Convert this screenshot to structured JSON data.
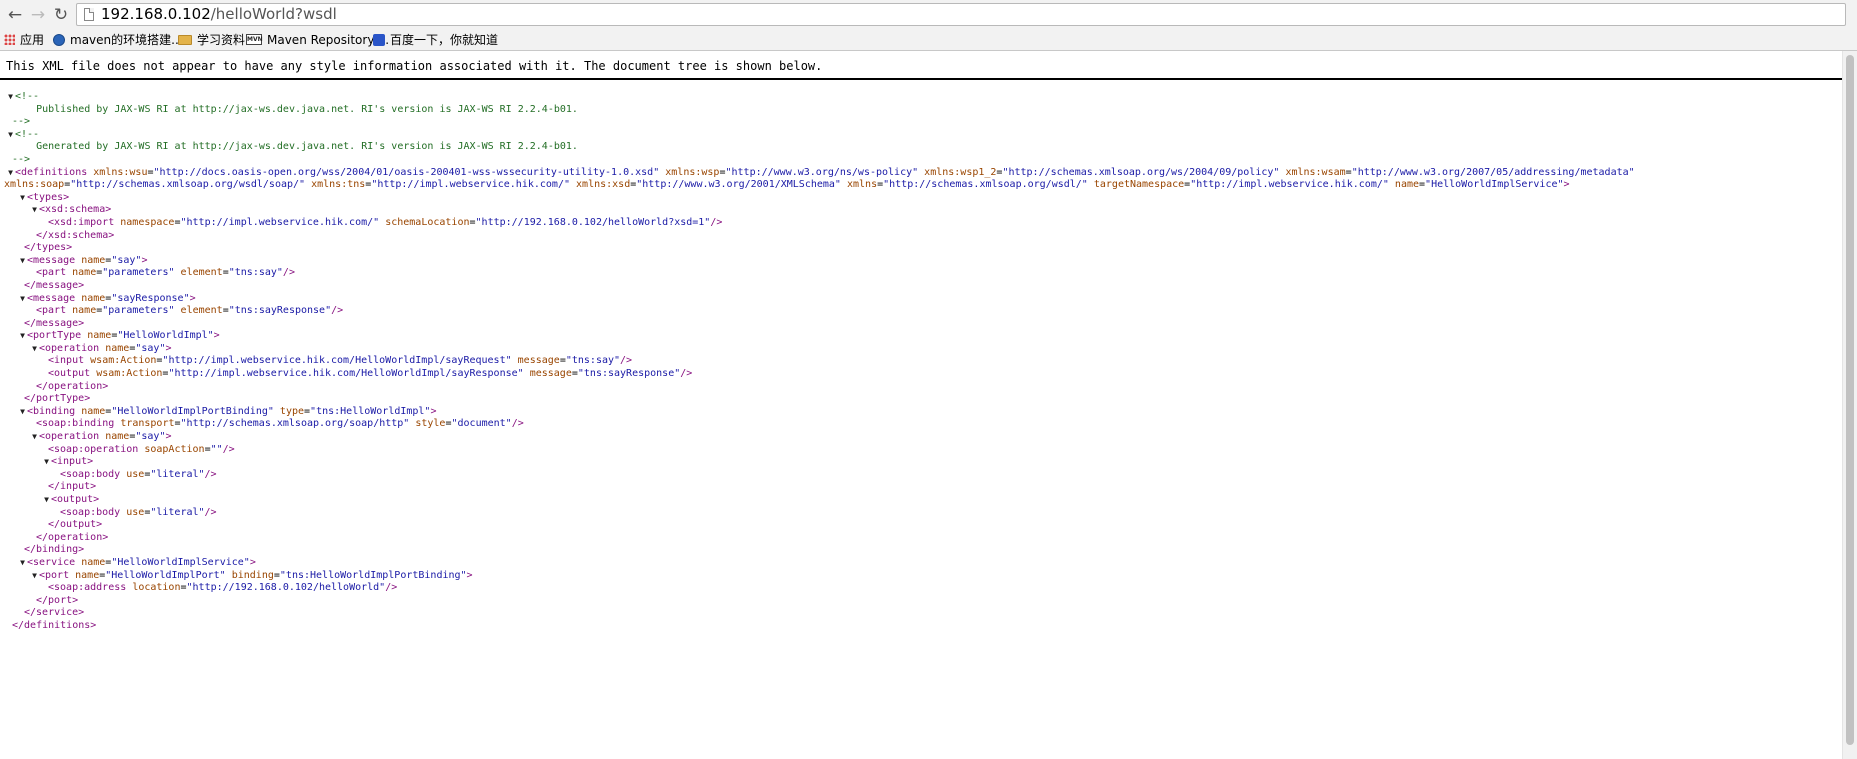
{
  "browser": {
    "back_icon": "←",
    "forward_icon": "→",
    "reload_icon": "↻",
    "url_host": "192.168.0.102",
    "url_path": "/helloWorld?wsdl"
  },
  "bookmarks": [
    {
      "label": "应用",
      "icon": "apps-icon"
    },
    {
      "label": "maven的环境搭建...",
      "icon": "site-icon"
    },
    {
      "label": "学习资料",
      "icon": "folder-icon"
    },
    {
      "label": "Maven Repository:...",
      "icon": "mvn-icon",
      "badge": "MVN"
    },
    {
      "label": "百度一下，你就知道",
      "icon": "baidu-icon"
    }
  ],
  "notice": "This XML file does not appear to have any style information associated with it. The document tree is shown below.",
  "lines": [
    {
      "toggle": "▼",
      "tokens": [
        {
          "t": "<!--",
          "c": "cm"
        }
      ]
    },
    {
      "tokens": [
        {
          "t": "    Published by JAX-WS RI at http://jax-ws.dev.java.net. RI's version is JAX-WS RI 2.2.4-b01.",
          "c": "cm"
        }
      ]
    },
    {
      "tokens": [
        {
          "t": "-->",
          "c": "cm"
        }
      ]
    },
    {
      "toggle": "▼",
      "tokens": [
        {
          "t": "<!--",
          "c": "cm"
        }
      ]
    },
    {
      "tokens": [
        {
          "t": "    Generated by JAX-WS RI at http://jax-ws.dev.java.net. RI's version is JAX-WS RI 2.2.4-b01.",
          "c": "cm"
        }
      ]
    },
    {
      "tokens": [
        {
          "t": "-->",
          "c": "cm"
        }
      ]
    },
    {
      "toggle": "▼",
      "tokens": [
        {
          "t": "<definitions",
          "c": "tag"
        },
        {
          "t": " "
        },
        {
          "t": "xmlns:wsu",
          "c": "an"
        },
        {
          "t": "="
        },
        {
          "t": "\"http://docs.oasis-open.org/wss/2004/01/oasis-200401-wss-wssecurity-utility-1.0.xsd\"",
          "c": "av"
        },
        {
          "t": " "
        },
        {
          "t": "xmlns:wsp",
          "c": "an"
        },
        {
          "t": "="
        },
        {
          "t": "\"http://www.w3.org/ns/ws-policy\"",
          "c": "av"
        },
        {
          "t": " "
        },
        {
          "t": "xmlns:wsp1_2",
          "c": "an"
        },
        {
          "t": "="
        },
        {
          "t": "\"http://schemas.xmlsoap.org/ws/2004/09/policy\"",
          "c": "av"
        },
        {
          "t": " "
        },
        {
          "t": "xmlns:wsam",
          "c": "an"
        },
        {
          "t": "="
        },
        {
          "t": "\"http://www.w3.org/2007/05/addressing/metadata\"",
          "c": "av"
        }
      ]
    },
    {
      "indent": -1,
      "tokens": [
        {
          "t": "xmlns:soap",
          "c": "an"
        },
        {
          "t": "="
        },
        {
          "t": "\"http://schemas.xmlsoap.org/wsdl/soap/\"",
          "c": "av"
        },
        {
          "t": " "
        },
        {
          "t": "xmlns:tns",
          "c": "an"
        },
        {
          "t": "="
        },
        {
          "t": "\"http://impl.webservice.hik.com/\"",
          "c": "av"
        },
        {
          "t": " "
        },
        {
          "t": "xmlns:xsd",
          "c": "an"
        },
        {
          "t": "="
        },
        {
          "t": "\"http://www.w3.org/2001/XMLSchema\"",
          "c": "av"
        },
        {
          "t": " "
        },
        {
          "t": "xmlns",
          "c": "an"
        },
        {
          "t": "="
        },
        {
          "t": "\"http://schemas.xmlsoap.org/wsdl/\"",
          "c": "av"
        },
        {
          "t": " "
        },
        {
          "t": "targetNamespace",
          "c": "an"
        },
        {
          "t": "="
        },
        {
          "t": "\"http://impl.webservice.hik.com/\"",
          "c": "av"
        },
        {
          "t": " "
        },
        {
          "t": "name",
          "c": "an"
        },
        {
          "t": "="
        },
        {
          "t": "\"HelloWorldImplService\"",
          "c": "av"
        },
        {
          "t": ">",
          "c": "tag"
        }
      ]
    },
    {
      "indent": 1,
      "toggle": "▼",
      "tokens": [
        {
          "t": "<types>",
          "c": "tag"
        }
      ]
    },
    {
      "indent": 2,
      "toggle": "▼",
      "tokens": [
        {
          "t": "<xsd:schema>",
          "c": "tag"
        }
      ]
    },
    {
      "indent": 3,
      "tokens": [
        {
          "t": "<xsd:import",
          "c": "tag"
        },
        {
          "t": " "
        },
        {
          "t": "namespace",
          "c": "an"
        },
        {
          "t": "="
        },
        {
          "t": "\"http://impl.webservice.hik.com/\"",
          "c": "av"
        },
        {
          "t": " "
        },
        {
          "t": "schemaLocation",
          "c": "an"
        },
        {
          "t": "="
        },
        {
          "t": "\"http://192.168.0.102/helloWorld?xsd=1\"",
          "c": "av"
        },
        {
          "t": "/>",
          "c": "tag"
        }
      ]
    },
    {
      "indent": 2,
      "tokens": [
        {
          "t": "</xsd:schema>",
          "c": "tag"
        }
      ]
    },
    {
      "indent": 1,
      "tokens": [
        {
          "t": "</types>",
          "c": "tag"
        }
      ]
    },
    {
      "indent": 1,
      "toggle": "▼",
      "tokens": [
        {
          "t": "<message",
          "c": "tag"
        },
        {
          "t": " "
        },
        {
          "t": "name",
          "c": "an"
        },
        {
          "t": "="
        },
        {
          "t": "\"say\"",
          "c": "av"
        },
        {
          "t": ">",
          "c": "tag"
        }
      ]
    },
    {
      "indent": 2,
      "tokens": [
        {
          "t": "<part",
          "c": "tag"
        },
        {
          "t": " "
        },
        {
          "t": "name",
          "c": "an"
        },
        {
          "t": "="
        },
        {
          "t": "\"parameters\"",
          "c": "av"
        },
        {
          "t": " "
        },
        {
          "t": "element",
          "c": "an"
        },
        {
          "t": "="
        },
        {
          "t": "\"tns:say\"",
          "c": "av"
        },
        {
          "t": "/>",
          "c": "tag"
        }
      ]
    },
    {
      "indent": 1,
      "tokens": [
        {
          "t": "</message>",
          "c": "tag"
        }
      ]
    },
    {
      "indent": 1,
      "toggle": "▼",
      "tokens": [
        {
          "t": "<message",
          "c": "tag"
        },
        {
          "t": " "
        },
        {
          "t": "name",
          "c": "an"
        },
        {
          "t": "="
        },
        {
          "t": "\"sayResponse\"",
          "c": "av"
        },
        {
          "t": ">",
          "c": "tag"
        }
      ]
    },
    {
      "indent": 2,
      "tokens": [
        {
          "t": "<part",
          "c": "tag"
        },
        {
          "t": " "
        },
        {
          "t": "name",
          "c": "an"
        },
        {
          "t": "="
        },
        {
          "t": "\"parameters\"",
          "c": "av"
        },
        {
          "t": " "
        },
        {
          "t": "element",
          "c": "an"
        },
        {
          "t": "="
        },
        {
          "t": "\"tns:sayResponse\"",
          "c": "av"
        },
        {
          "t": "/>",
          "c": "tag"
        }
      ]
    },
    {
      "indent": 1,
      "tokens": [
        {
          "t": "</message>",
          "c": "tag"
        }
      ]
    },
    {
      "indent": 1,
      "toggle": "▼",
      "tokens": [
        {
          "t": "<portType",
          "c": "tag"
        },
        {
          "t": " "
        },
        {
          "t": "name",
          "c": "an"
        },
        {
          "t": "="
        },
        {
          "t": "\"HelloWorldImpl\"",
          "c": "av"
        },
        {
          "t": ">",
          "c": "tag"
        }
      ]
    },
    {
      "indent": 2,
      "toggle": "▼",
      "tokens": [
        {
          "t": "<operation",
          "c": "tag"
        },
        {
          "t": " "
        },
        {
          "t": "name",
          "c": "an"
        },
        {
          "t": "="
        },
        {
          "t": "\"say\"",
          "c": "av"
        },
        {
          "t": ">",
          "c": "tag"
        }
      ]
    },
    {
      "indent": 3,
      "tokens": [
        {
          "t": "<input",
          "c": "tag"
        },
        {
          "t": " "
        },
        {
          "t": "wsam:Action",
          "c": "an"
        },
        {
          "t": "="
        },
        {
          "t": "\"http://impl.webservice.hik.com/HelloWorldImpl/sayRequest\"",
          "c": "av"
        },
        {
          "t": " "
        },
        {
          "t": "message",
          "c": "an"
        },
        {
          "t": "="
        },
        {
          "t": "\"tns:say\"",
          "c": "av"
        },
        {
          "t": "/>",
          "c": "tag"
        }
      ]
    },
    {
      "indent": 3,
      "tokens": [
        {
          "t": "<output",
          "c": "tag"
        },
        {
          "t": " "
        },
        {
          "t": "wsam:Action",
          "c": "an"
        },
        {
          "t": "="
        },
        {
          "t": "\"http://impl.webservice.hik.com/HelloWorldImpl/sayResponse\"",
          "c": "av"
        },
        {
          "t": " "
        },
        {
          "t": "message",
          "c": "an"
        },
        {
          "t": "="
        },
        {
          "t": "\"tns:sayResponse\"",
          "c": "av"
        },
        {
          "t": "/>",
          "c": "tag"
        }
      ]
    },
    {
      "indent": 2,
      "tokens": [
        {
          "t": "</operation>",
          "c": "tag"
        }
      ]
    },
    {
      "indent": 1,
      "tokens": [
        {
          "t": "</portType>",
          "c": "tag"
        }
      ]
    },
    {
      "indent": 1,
      "toggle": "▼",
      "tokens": [
        {
          "t": "<binding",
          "c": "tag"
        },
        {
          "t": " "
        },
        {
          "t": "name",
          "c": "an"
        },
        {
          "t": "="
        },
        {
          "t": "\"HelloWorldImplPortBinding\"",
          "c": "av"
        },
        {
          "t": " "
        },
        {
          "t": "type",
          "c": "an"
        },
        {
          "t": "="
        },
        {
          "t": "\"tns:HelloWorldImpl\"",
          "c": "av"
        },
        {
          "t": ">",
          "c": "tag"
        }
      ]
    },
    {
      "indent": 2,
      "tokens": [
        {
          "t": "<soap:binding",
          "c": "tag"
        },
        {
          "t": " "
        },
        {
          "t": "transport",
          "c": "an"
        },
        {
          "t": "="
        },
        {
          "t": "\"http://schemas.xmlsoap.org/soap/http\"",
          "c": "av"
        },
        {
          "t": " "
        },
        {
          "t": "style",
          "c": "an"
        },
        {
          "t": "="
        },
        {
          "t": "\"document\"",
          "c": "av"
        },
        {
          "t": "/>",
          "c": "tag"
        }
      ]
    },
    {
      "indent": 2,
      "toggle": "▼",
      "tokens": [
        {
          "t": "<operation",
          "c": "tag"
        },
        {
          "t": " "
        },
        {
          "t": "name",
          "c": "an"
        },
        {
          "t": "="
        },
        {
          "t": "\"say\"",
          "c": "av"
        },
        {
          "t": ">",
          "c": "tag"
        }
      ]
    },
    {
      "indent": 3,
      "tokens": [
        {
          "t": "<soap:operation",
          "c": "tag"
        },
        {
          "t": " "
        },
        {
          "t": "soapAction",
          "c": "an"
        },
        {
          "t": "="
        },
        {
          "t": "\"\"",
          "c": "av"
        },
        {
          "t": "/>",
          "c": "tag"
        }
      ]
    },
    {
      "indent": 3,
      "toggle": "▼",
      "tokens": [
        {
          "t": "<input>",
          "c": "tag"
        }
      ]
    },
    {
      "indent": 4,
      "tokens": [
        {
          "t": "<soap:body",
          "c": "tag"
        },
        {
          "t": " "
        },
        {
          "t": "use",
          "c": "an"
        },
        {
          "t": "="
        },
        {
          "t": "\"literal\"",
          "c": "av"
        },
        {
          "t": "/>",
          "c": "tag"
        }
      ]
    },
    {
      "indent": 3,
      "tokens": [
        {
          "t": "</input>",
          "c": "tag"
        }
      ]
    },
    {
      "indent": 3,
      "toggle": "▼",
      "tokens": [
        {
          "t": "<output>",
          "c": "tag"
        }
      ]
    },
    {
      "indent": 4,
      "tokens": [
        {
          "t": "<soap:body",
          "c": "tag"
        },
        {
          "t": " "
        },
        {
          "t": "use",
          "c": "an"
        },
        {
          "t": "="
        },
        {
          "t": "\"literal\"",
          "c": "av"
        },
        {
          "t": "/>",
          "c": "tag"
        }
      ]
    },
    {
      "indent": 3,
      "tokens": [
        {
          "t": "</output>",
          "c": "tag"
        }
      ]
    },
    {
      "indent": 2,
      "tokens": [
        {
          "t": "</operation>",
          "c": "tag"
        }
      ]
    },
    {
      "indent": 1,
      "tokens": [
        {
          "t": "</binding>",
          "c": "tag"
        }
      ]
    },
    {
      "indent": 1,
      "toggle": "▼",
      "tokens": [
        {
          "t": "<service",
          "c": "tag"
        },
        {
          "t": " "
        },
        {
          "t": "name",
          "c": "an"
        },
        {
          "t": "="
        },
        {
          "t": "\"HelloWorldImplService\"",
          "c": "av"
        },
        {
          "t": ">",
          "c": "tag"
        }
      ]
    },
    {
      "indent": 2,
      "toggle": "▼",
      "tokens": [
        {
          "t": "<port",
          "c": "tag"
        },
        {
          "t": " "
        },
        {
          "t": "name",
          "c": "an"
        },
        {
          "t": "="
        },
        {
          "t": "\"HelloWorldImplPort\"",
          "c": "av"
        },
        {
          "t": " "
        },
        {
          "t": "binding",
          "c": "an"
        },
        {
          "t": "="
        },
        {
          "t": "\"tns:HelloWorldImplPortBinding\"",
          "c": "av"
        },
        {
          "t": ">",
          "c": "tag"
        }
      ]
    },
    {
      "indent": 3,
      "tokens": [
        {
          "t": "<soap:address",
          "c": "tag"
        },
        {
          "t": " "
        },
        {
          "t": "location",
          "c": "an"
        },
        {
          "t": "="
        },
        {
          "t": "\"http://192.168.0.102/helloWorld\"",
          "c": "av"
        },
        {
          "t": "/>",
          "c": "tag"
        }
      ]
    },
    {
      "indent": 2,
      "tokens": [
        {
          "t": "</port>",
          "c": "tag"
        }
      ]
    },
    {
      "indent": 1,
      "tokens": [
        {
          "t": "</service>",
          "c": "tag"
        }
      ]
    },
    {
      "tokens": [
        {
          "t": "</definitions>",
          "c": "tag"
        }
      ]
    }
  ]
}
